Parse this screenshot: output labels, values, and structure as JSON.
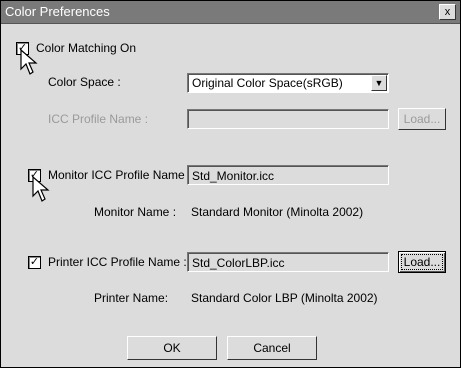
{
  "window": {
    "title": "Color Preferences",
    "close_label": "x"
  },
  "color_matching": {
    "label": "Color Matching On",
    "checked": true
  },
  "color_space": {
    "label": "Color Space :",
    "selected": "Original Color Space(sRGB)"
  },
  "icc_profile": {
    "label": "ICC Profile Name :",
    "value": "",
    "load_label": "Load..."
  },
  "monitor": {
    "check_label": "Monitor ICC Profile Name :",
    "checked": true,
    "profile_value": "Std_Monitor.icc",
    "name_label": "Monitor Name :",
    "name_value": "Standard Monitor (Minolta 2002)"
  },
  "printer": {
    "check_label": "Printer ICC Profile Name :",
    "checked": true,
    "profile_value": "Std_ColorLBP.icc",
    "load_label": "Load...",
    "name_label": "Printer Name:",
    "name_value": "Standard Color LBP (Minolta 2002)"
  },
  "buttons": {
    "ok": "OK",
    "cancel": "Cancel"
  },
  "icons": {
    "check": "✓",
    "dropdown": "▼"
  }
}
